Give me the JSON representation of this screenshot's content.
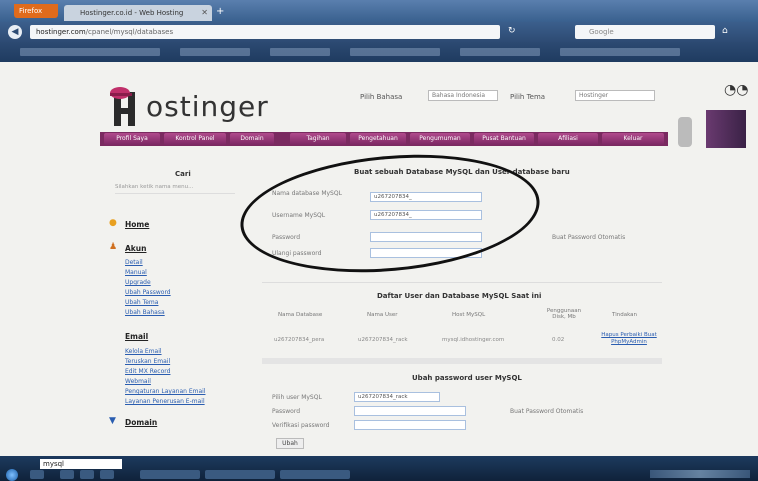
{
  "browser": {
    "firefox_label": "Firefox",
    "tab_title": "Hostinger.co.id - Web Hosting",
    "url_domain": "hostinger.com",
    "url_path": "/cpanel/mysql/databases",
    "search_placeholder": "Google"
  },
  "header": {
    "logo_text": "ostinger",
    "language_label": "Pilih Bahasa",
    "language_value": "Bahasa Indonesia",
    "theme_label": "Pilih Tema",
    "theme_value": "Hostinger"
  },
  "menu": [
    {
      "label": "Profil Saya"
    },
    {
      "label": "Kontrol Panel"
    },
    {
      "label": "Domain"
    },
    {
      "label": "Tagihan"
    },
    {
      "label": "Pengetahuan"
    },
    {
      "label": "Pengumuman"
    },
    {
      "label": "Pusat Bantuan"
    },
    {
      "label": "Afiliasi"
    },
    {
      "label": "Keluar"
    }
  ],
  "sidebar": {
    "search_title": "Cari",
    "search_placeholder": "Silahkan ketik nama menu...",
    "home_label": "Home",
    "akun_label": "Akun",
    "akun_links": [
      "Detail",
      "Manual",
      "Upgrade",
      "Ubah Password",
      "Ubah Tema",
      "Ubah Bahasa"
    ],
    "email_label": "Email",
    "email_links": [
      "Kelola Email",
      "Teruskan Email",
      "Edit MX Record",
      "Webmail",
      "Pengaturan Layanan Email",
      "Layanan Penerusan E-mail"
    ],
    "domain_label": "Domain"
  },
  "create_form": {
    "title": "Buat sebuah Database MySQL dan User database baru",
    "db_name_label": "Nama database MySQL",
    "db_name_value": "u267207834_",
    "user_label": "Username MySQL",
    "user_value": "u267207834_",
    "password_label": "Password",
    "repeat_label": "Ulangi password",
    "generate_label": "Buat Password Otomatis"
  },
  "list_table": {
    "title": "Daftar User dan Database MySQL Saat ini",
    "headers": [
      "Nama Database",
      "Nama User",
      "Host MySQL",
      "Penggunaan Disk, Mb",
      "Tindakan"
    ],
    "row": [
      "u267207834_pera",
      "u267207834_rack",
      "mysql.idhostinger.com",
      "0.02"
    ],
    "action_text": "Hapus Perbaiki Buat PhpMyAdmin"
  },
  "change_form": {
    "title": "Ubah password user MySQL",
    "user_label": "Pilih user MySQL",
    "user_value": "u267207834_rack",
    "password_label": "Password",
    "repeat_label": "Verifikasi password",
    "generate_label": "Buat Password Otomatis",
    "submit_label": "Ubah"
  },
  "taskbar": {
    "search_value": "mysql"
  }
}
